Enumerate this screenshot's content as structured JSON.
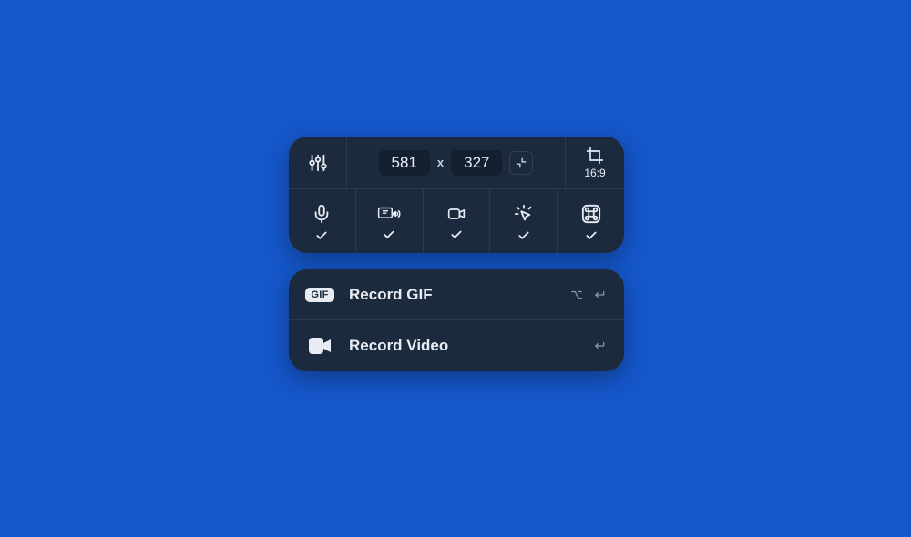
{
  "dimensions": {
    "width": "581",
    "separator": "x",
    "height": "327"
  },
  "aspect": {
    "label": "16:9"
  },
  "actions": {
    "gif": {
      "badge": "GIF",
      "label": "Record GIF"
    },
    "video": {
      "label": "Record Video"
    }
  }
}
